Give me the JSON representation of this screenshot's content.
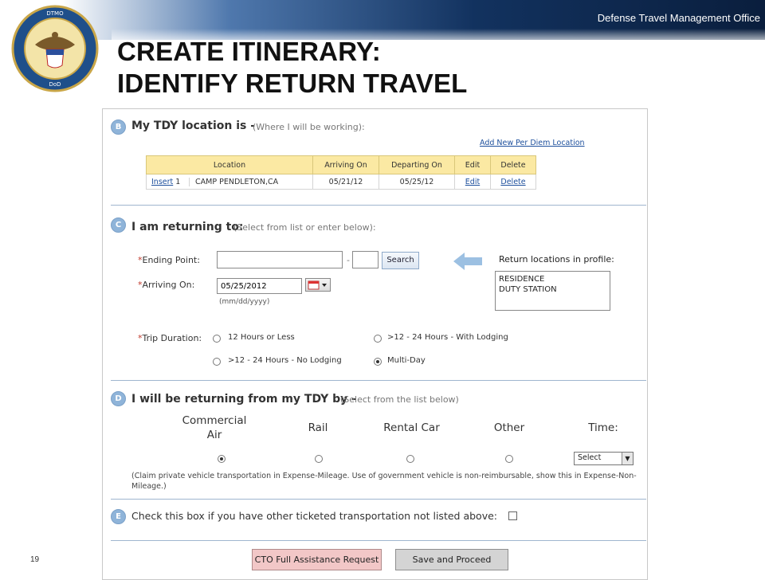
{
  "header": {
    "org_name": "Defense Travel Management Office",
    "title_line1": "CREATE ITINERARY:",
    "title_line2": "IDENTIFY RETURN TRAVEL",
    "slide_number": "19"
  },
  "seal": {
    "top_text": "Defense Travel Management Office",
    "bottom_text": "Department of Defense"
  },
  "section_b": {
    "badge": "B",
    "heading": "My TDY location is  -",
    "hint": "(Where I will be working):",
    "add_link": "Add New Per Diem Location",
    "columns": [
      "Location",
      "Arriving On",
      "Departing On",
      "Edit",
      "Delete"
    ],
    "rows": [
      {
        "insert_link": "Insert",
        "index": "1",
        "location": "CAMP PENDLETON,CA",
        "arriving": "05/21/12",
        "departing": "05/25/12",
        "edit": "Edit",
        "delete": "Delete"
      }
    ]
  },
  "section_c": {
    "badge": "C",
    "heading": "I am returning to:",
    "hint": "(Select from list or enter below):",
    "ending_point_label": "Ending Point:",
    "ending_point_value": "",
    "state_value": "",
    "search_button": "Search",
    "return_locations_label": "Return locations in profile:",
    "return_locations": [
      "RESIDENCE",
      "DUTY STATION"
    ],
    "arriving_label": "Arriving On:",
    "arriving_value": "05/25/2012",
    "date_format": "(mm/dd/yyyy)",
    "trip_duration_label": "Trip Duration:",
    "durations": [
      "12 Hours or Less",
      ">12 - 24 Hours - With Lodging",
      ">12 - 24 Hours - No Lodging",
      "Multi-Day"
    ],
    "selected_duration": "Multi-Day"
  },
  "section_d": {
    "badge": "D",
    "heading": "I will be returning from my TDY by -",
    "hint": "(Select from the list below)",
    "modes": [
      "Commercial Air",
      "Rail",
      "Rental Car",
      "Other"
    ],
    "selected_mode": "Commercial Air",
    "time_label": "Time:",
    "time_select": "Select",
    "note": "(Claim private vehicle transportation in Expense-Mileage. Use of government vehicle is non-reimbursable, show this in Expense-Non-Mileage.)"
  },
  "section_e": {
    "badge": "E",
    "text": "Check this box if you have other ticketed transportation not listed above:"
  },
  "buttons": {
    "cto": "CTO Full Assistance Request",
    "save": "Save and Proceed"
  },
  "colors": {
    "badge": "#8fb4d9",
    "table_header": "#fbe9a3",
    "link": "#1d4f9c",
    "required": "#c0392b",
    "header_dark": "#0a1e3d"
  }
}
